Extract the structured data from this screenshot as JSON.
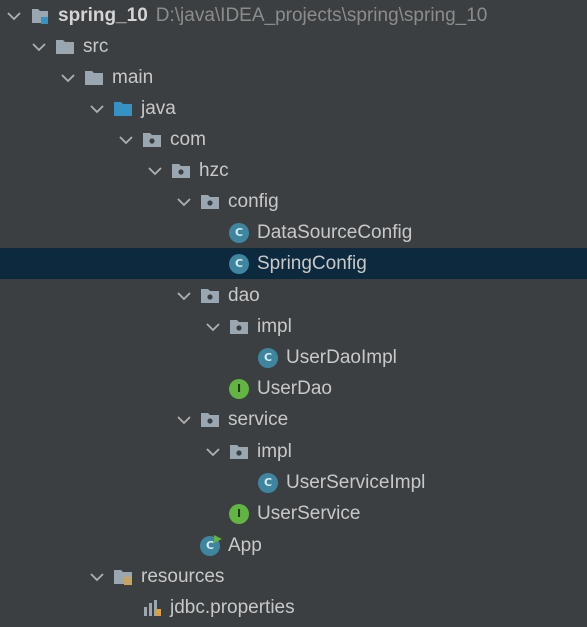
{
  "project": {
    "name": "spring_10",
    "path": "D:\\java\\IDEA_projects\\spring\\spring_10"
  },
  "tree": {
    "src": "src",
    "main": "main",
    "java": "java",
    "com": "com",
    "hzc": "hzc",
    "config": "config",
    "DataSourceConfig": "DataSourceConfig",
    "SpringConfig": "SpringConfig",
    "dao": "dao",
    "dao_impl": "impl",
    "UserDaoImpl": "UserDaoImpl",
    "UserDao": "UserDao",
    "service": "service",
    "service_impl": "impl",
    "UserServiceImpl": "UserServiceImpl",
    "UserService": "UserService",
    "App": "App",
    "resources": "resources",
    "jdbc_properties": "jdbc.properties"
  },
  "icons": {
    "class_badge": "C",
    "interface_badge": "I"
  },
  "selected_item": "SpringConfig",
  "colors": {
    "background": "#3c3f41",
    "selection": "#0d293e",
    "folder": "#9aa7b0",
    "source_folder": "#3592c4",
    "class_icon": "#3e86a0",
    "interface_icon": "#62b543",
    "path_text": "#8c8c8c"
  }
}
